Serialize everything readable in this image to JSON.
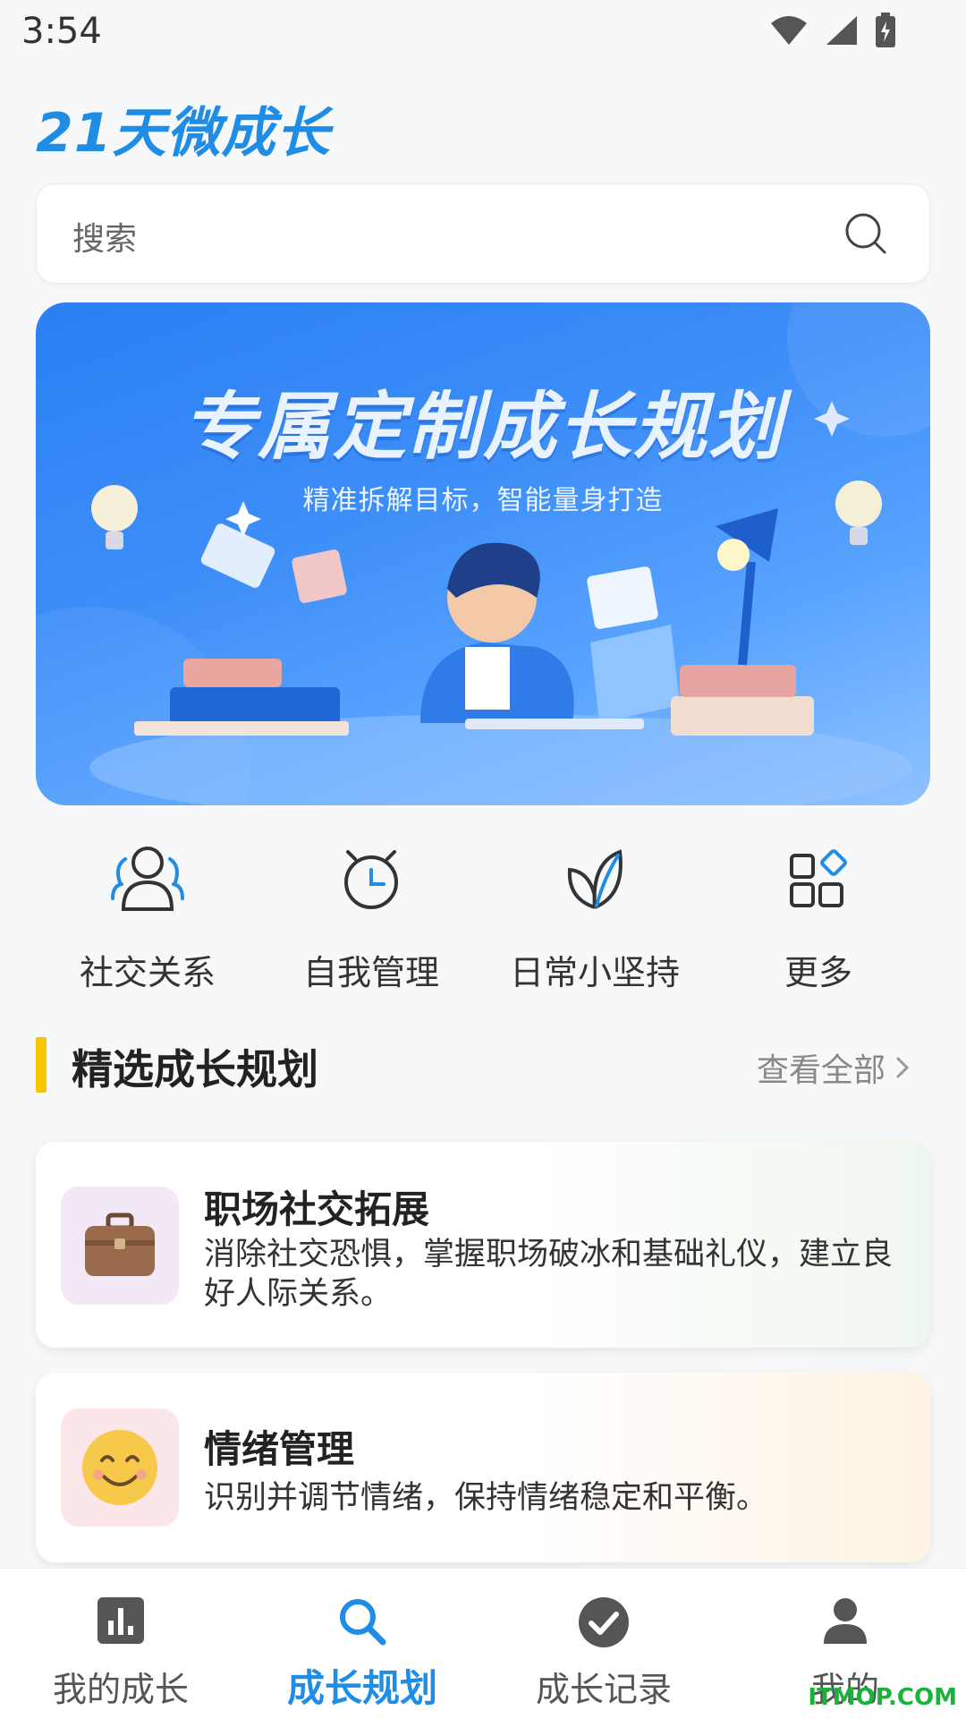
{
  "status_bar": {
    "time": "3:54"
  },
  "header": {
    "title": "21天微成长"
  },
  "search": {
    "placeholder": "搜索"
  },
  "banner": {
    "title": "专属定制成长规划",
    "subtitle": "精准拆解目标，智能量身打造"
  },
  "categories": [
    {
      "label": "社交关系",
      "icon": "people-icon"
    },
    {
      "label": "自我管理",
      "icon": "alarm-clock-icon"
    },
    {
      "label": "日常小坚持",
      "icon": "leaf-icon"
    },
    {
      "label": "更多",
      "icon": "grid-icon"
    }
  ],
  "section": {
    "title": "精选成长规划",
    "more_label": "查看全部"
  },
  "plans": [
    {
      "title": "职场社交拓展",
      "desc": "消除社交恐惧，掌握职场破冰和基础礼仪，建立良好人际关系。",
      "icon": "briefcase-icon"
    },
    {
      "title": "情绪管理",
      "desc": "识别并调节情绪，保持情绪稳定和平衡。",
      "icon": "smiley-icon"
    }
  ],
  "bottom_nav": [
    {
      "label": "我的成长",
      "icon": "bar-chart-icon",
      "active": false
    },
    {
      "label": "成长规划",
      "icon": "search-icon",
      "active": true
    },
    {
      "label": "成长记录",
      "icon": "check-circle-icon",
      "active": false
    },
    {
      "label": "我的",
      "icon": "person-icon",
      "active": false
    }
  ],
  "watermark": "ITMOP.COM",
  "colors": {
    "accent": "#1f8ce6",
    "section_bar": "#f7c600"
  }
}
